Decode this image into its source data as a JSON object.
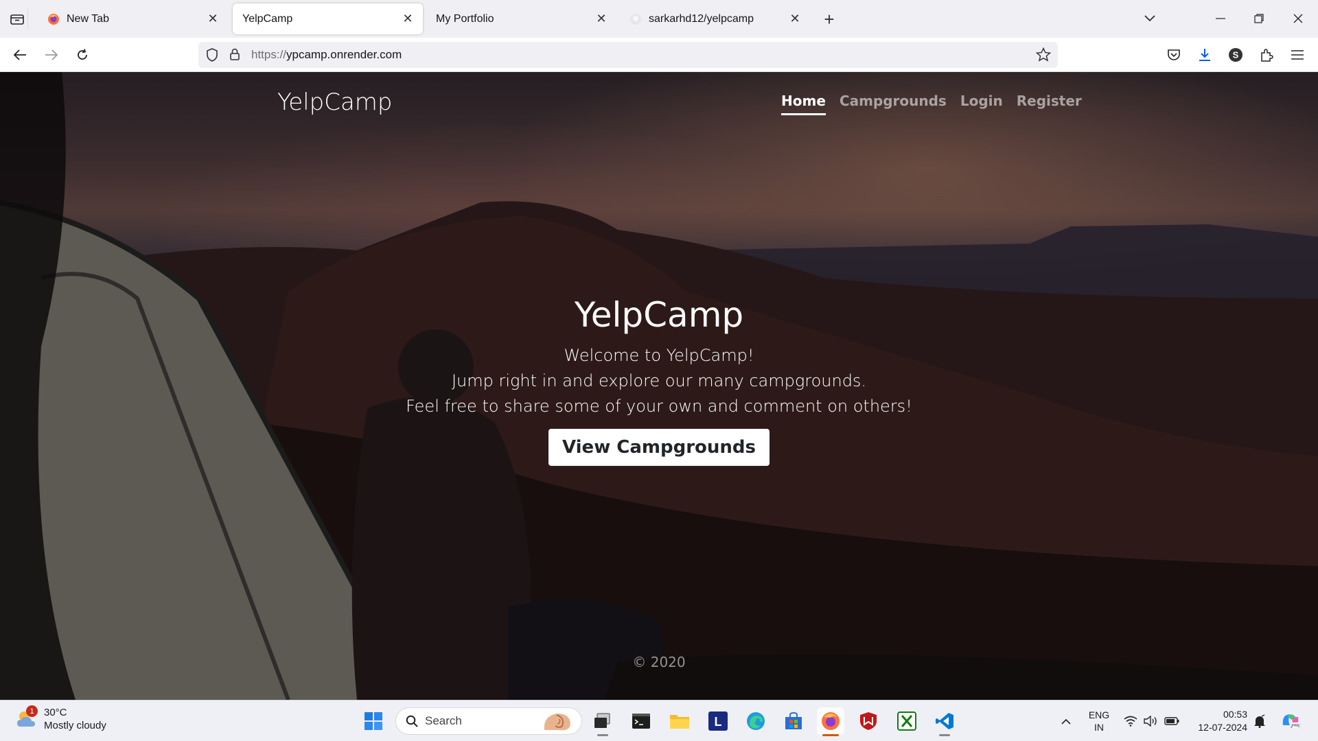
{
  "browser": {
    "tabs": [
      {
        "label": "New Tab",
        "icon": "firefox-icon",
        "active": false
      },
      {
        "label": "YelpCamp",
        "icon": "none",
        "active": true
      },
      {
        "label": "My Portfolio",
        "icon": "none",
        "active": false
      },
      {
        "label": "sarkarhd12/yelpcamp",
        "icon": "github-icon",
        "active": false
      }
    ],
    "url_scheme": "https://",
    "url_host": "ypcamp.onrender.com",
    "profile_letter": "S"
  },
  "site": {
    "brand": "YelpCamp",
    "nav": [
      {
        "label": "Home",
        "active": true
      },
      {
        "label": "Campgrounds",
        "active": false
      },
      {
        "label": "Login",
        "active": false
      },
      {
        "label": "Register",
        "active": false
      }
    ],
    "hero": {
      "title": "YelpCamp",
      "line1": "Welcome to YelpCamp!",
      "line2": "Jump right in and explore our many campgrounds.",
      "line3": "Feel free to share some of your own and comment on others!",
      "button": "View Campgrounds"
    },
    "footer": "© 2020"
  },
  "taskbar": {
    "weather_temp": "30°C",
    "weather_desc": "Mostly cloudy",
    "weather_badge": "1",
    "search_label": "Search",
    "lang_top": "ENG",
    "lang_bottom": "IN",
    "time": "00:53",
    "date": "12-07-2024",
    "app_letter_l": "L"
  },
  "colors": {
    "accent_firefox": "#ff7139",
    "download_blue": "#0060df",
    "browser_chrome": "#f0f0f4"
  }
}
